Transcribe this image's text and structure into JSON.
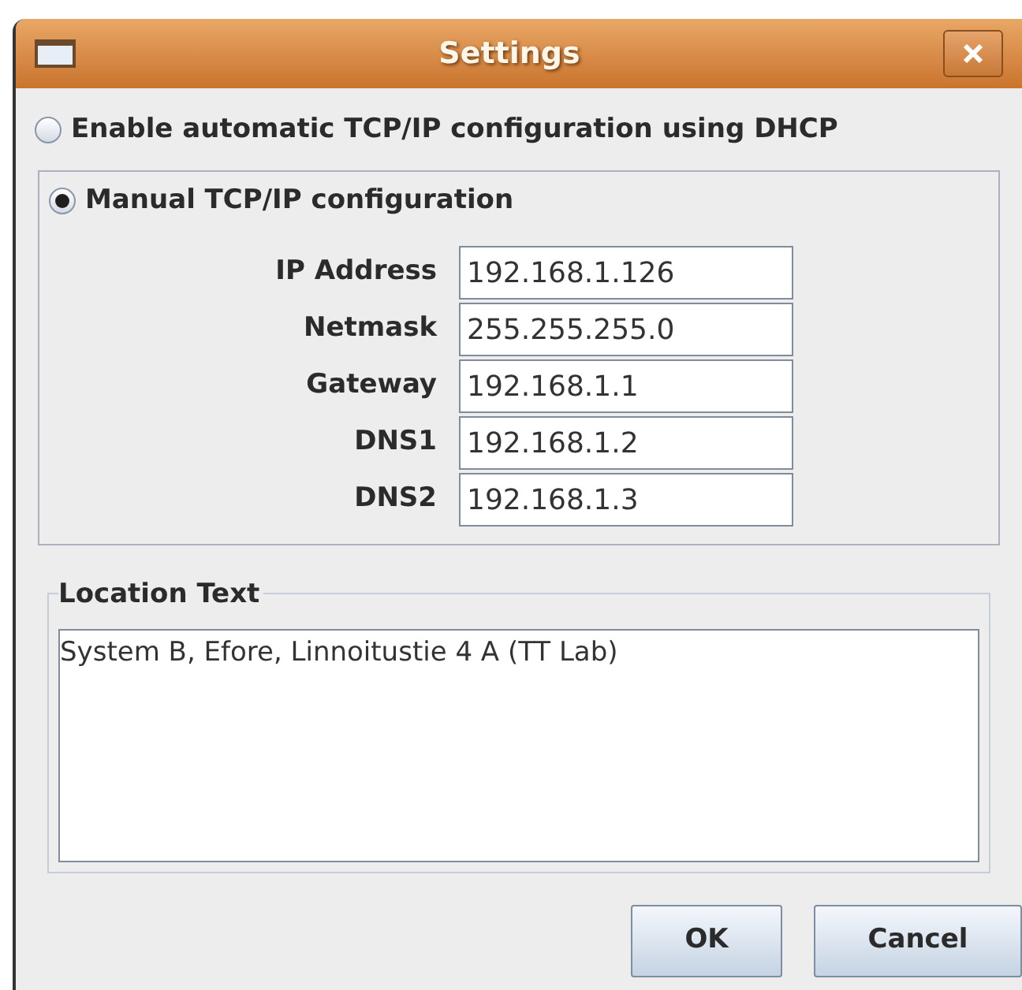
{
  "window": {
    "title": "Settings"
  },
  "modes": [
    {
      "label": "Enable automatic TCP/IP configuration using DHCP",
      "selected": false
    },
    {
      "label": "Manual TCP/IP configuration",
      "selected": true
    }
  ],
  "fields": [
    {
      "label": "IP Address",
      "value": "192.168.1.126"
    },
    {
      "label": "Netmask",
      "value": "255.255.255.0"
    },
    {
      "label": "Gateway",
      "value": "192.168.1.1"
    },
    {
      "label": "DNS1",
      "value": "192.168.1.2"
    },
    {
      "label": "DNS2",
      "value": "192.168.1.3"
    }
  ],
  "location": {
    "title": "Location Text",
    "value": "System B, Efore, Linnoitustie 4 A (TT Lab)"
  },
  "buttons": [
    "OK",
    "Cancel"
  ]
}
